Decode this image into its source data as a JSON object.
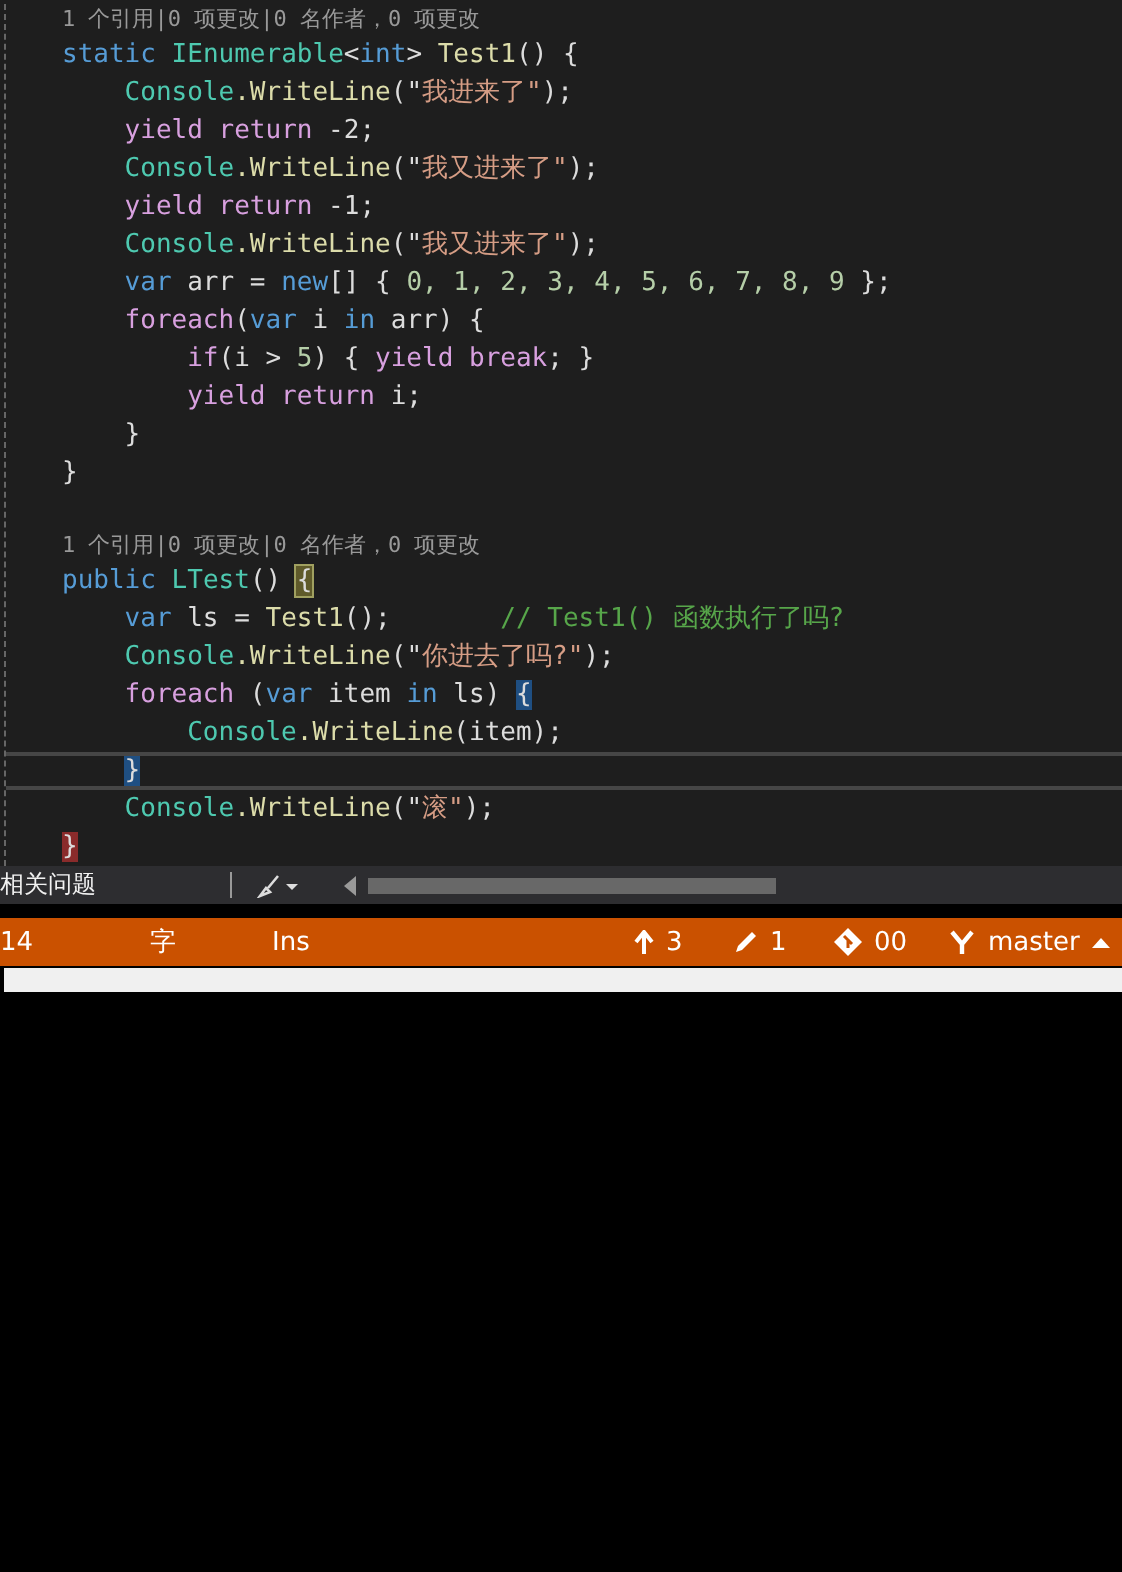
{
  "editor": {
    "lines": [
      {
        "kind": "codelens",
        "current": false,
        "text": "1 个引用|0 项更改|0 名作者，0 项更改"
      },
      {
        "kind": "code",
        "current": false,
        "tokens": [
          {
            "text": "static ",
            "kind": "keyword"
          },
          {
            "text": "IEnumerable",
            "kind": "type"
          },
          {
            "text": "<",
            "kind": "plain"
          },
          {
            "text": "int",
            "kind": "keyword"
          },
          {
            "text": "> ",
            "kind": "plain"
          },
          {
            "text": "Test1",
            "kind": "method"
          },
          {
            "text": "() {",
            "kind": "plain"
          }
        ],
        "children": [
          {
            "kind": "code",
            "current": false,
            "tokens": [
              {
                "text": "Console",
                "kind": "type"
              },
              {
                "text": ".WriteLine",
                "kind": "method"
              },
              {
                "text": "(\"",
                "kind": "plain"
              },
              {
                "text": "我进来了\"",
                "kind": "string"
              },
              {
                "text": ");",
                "kind": "plain"
              }
            ]
          },
          {
            "kind": "code",
            "current": false,
            "tokens": [
              {
                "text": "yield return",
                "kind": "control"
              },
              {
                "text": " -2;",
                "kind": "plain"
              }
            ]
          },
          {
            "kind": "code",
            "current": false,
            "tokens": [
              {
                "text": "Console",
                "kind": "type"
              },
              {
                "text": ".WriteLine",
                "kind": "method"
              },
              {
                "text": "(\"",
                "kind": "plain"
              },
              {
                "text": "我又进来了\"",
                "kind": "string"
              },
              {
                "text": ");",
                "kind": "plain"
              }
            ]
          },
          {
            "kind": "code",
            "current": false,
            "tokens": [
              {
                "text": "yield return",
                "kind": "control"
              },
              {
                "text": " -1;",
                "kind": "plain"
              }
            ]
          },
          {
            "kind": "code",
            "current": false,
            "tokens": [
              {
                "text": "Console",
                "kind": "type"
              },
              {
                "text": ".WriteLine",
                "kind": "method"
              },
              {
                "text": "(\"",
                "kind": "plain"
              },
              {
                "text": "我又进来了\"",
                "kind": "string"
              },
              {
                "text": ");",
                "kind": "plain"
              }
            ]
          },
          {
            "kind": "code",
            "current": false,
            "tokens": [
              {
                "text": "var",
                "kind": "keyword"
              },
              {
                "text": " arr = ",
                "kind": "plain"
              },
              {
                "text": "new",
                "kind": "keyword"
              },
              {
                "text": "[] { ",
                "kind": "plain"
              },
              {
                "text": "0, 1, 2, 3, 4, 5, 6, 7, 8, 9",
                "kind": "number"
              },
              {
                "text": " };",
                "kind": "plain"
              }
            ]
          },
          {
            "kind": "code",
            "current": false,
            "tokens": [
              {
                "text": "foreach",
                "kind": "control"
              },
              {
                "text": "(",
                "kind": "plain"
              },
              {
                "text": "var",
                "kind": "keyword"
              },
              {
                "text": " i ",
                "kind": "plain"
              },
              {
                "text": "in",
                "kind": "keyword"
              },
              {
                "text": " arr) {",
                "kind": "plain"
              }
            ],
            "children": [
              {
                "kind": "code",
                "current": false,
                "tokens": [
                  {
                    "text": "if",
                    "kind": "control"
                  },
                  {
                    "text": "(i > ",
                    "kind": "plain"
                  },
                  {
                    "text": "5",
                    "kind": "number"
                  },
                  {
                    "text": ") { ",
                    "kind": "plain"
                  },
                  {
                    "text": "yield break",
                    "kind": "control"
                  },
                  {
                    "text": "; }",
                    "kind": "plain"
                  }
                ]
              },
              {
                "kind": "code",
                "current": false,
                "tokens": [
                  {
                    "text": "yield return",
                    "kind": "control"
                  },
                  {
                    "text": " i;",
                    "kind": "plain"
                  }
                ]
              }
            ]
          },
          {
            "kind": "code",
            "current": false,
            "tokens": [
              {
                "text": "}",
                "kind": "plain"
              }
            ]
          }
        ]
      },
      {
        "kind": "code",
        "current": false,
        "tokens": [
          {
            "text": "}",
            "kind": "plain"
          }
        ]
      },
      {
        "kind": "blank",
        "current": false
      },
      {
        "kind": "codelens",
        "current": false,
        "text": "1 个引用|0 项更改|0 名作者，0 项更改"
      },
      {
        "kind": "code",
        "current": false,
        "tokens": [
          {
            "text": "public ",
            "kind": "keyword"
          },
          {
            "text": "LTest",
            "kind": "type"
          },
          {
            "text": "() ",
            "kind": "plain"
          },
          {
            "text": "{",
            "kind": "plain",
            "highlighted": true
          }
        ],
        "children": [
          {
            "kind": "code",
            "current": false,
            "tokens": [
              {
                "text": "var",
                "kind": "keyword"
              },
              {
                "text": " ls = ",
                "kind": "plain"
              },
              {
                "text": "Test1",
                "kind": "method"
              },
              {
                "text": "();       ",
                "kind": "plain"
              },
              {
                "text": "// Test1() 函数执行了吗?",
                "kind": "comment"
              }
            ]
          },
          {
            "kind": "code",
            "current": false,
            "tokens": [
              {
                "text": "Console",
                "kind": "type"
              },
              {
                "text": ".WriteLine",
                "kind": "method"
              },
              {
                "text": "(\"",
                "kind": "plain"
              },
              {
                "text": "你进去了吗?\"",
                "kind": "string"
              },
              {
                "text": ");",
                "kind": "plain"
              }
            ]
          },
          {
            "kind": "code",
            "current": false,
            "tokens": [
              {
                "text": "foreach",
                "kind": "control"
              },
              {
                "text": " (",
                "kind": "plain"
              },
              {
                "text": "var",
                "kind": "keyword"
              },
              {
                "text": " item ",
                "kind": "plain"
              },
              {
                "text": "in",
                "kind": "keyword"
              },
              {
                "text": " ls) ",
                "kind": "plain"
              },
              {
                "text": "{",
                "kind": "plain",
                "matched": true
              }
            ],
            "children": [
              {
                "kind": "code",
                "current": false,
                "tokens": [
                  {
                    "text": "Console",
                    "kind": "type"
                  },
                  {
                    "text": ".WriteLine",
                    "kind": "method"
                  },
                  {
                    "text": "(item);",
                    "kind": "plain"
                  }
                ]
              }
            ]
          },
          {
            "kind": "code",
            "current": true,
            "tokens": [
              {
                "text": "}",
                "kind": "plain",
                "matched": true
              }
            ]
          },
          {
            "kind": "code",
            "current": false,
            "tokens": [
              {
                "text": "Console",
                "kind": "type"
              },
              {
                "text": ".WriteLine",
                "kind": "method"
              },
              {
                "text": "(\"",
                "kind": "plain"
              },
              {
                "text": "滚\"",
                "kind": "string"
              },
              {
                "text": ");",
                "kind": "plain"
              }
            ]
          }
        ]
      },
      {
        "kind": "code",
        "current": false,
        "tokens": [
          {
            "text": "}",
            "kind": "plain",
            "error": true
          }
        ]
      }
    ]
  },
  "error_bar": {
    "label": "相关问题"
  },
  "status_bar": {
    "line": "14",
    "char": "字",
    "mode": "Ins",
    "pushes": "3",
    "edits": "1",
    "repo": "00",
    "branch": "master"
  }
}
